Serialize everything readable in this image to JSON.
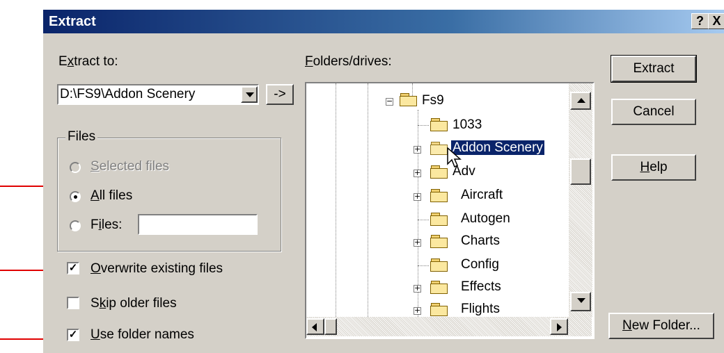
{
  "window": {
    "title": "Extract",
    "help_btn": "?",
    "close_btn": "X"
  },
  "extract_to": {
    "label": "Extract to:",
    "value": "D:\\FS9\\Addon Scenery",
    "go_btn": "->"
  },
  "files_group": {
    "label": "Files",
    "selected_files": "Selected files",
    "all_files": "All files",
    "files": "Files:",
    "files_value": ""
  },
  "options": {
    "overwrite": {
      "label": "Overwrite existing files",
      "checked": true
    },
    "skip_older": {
      "label": "Skip older files",
      "checked": false
    },
    "use_folder_names": {
      "label": "Use folder names",
      "checked": true
    }
  },
  "folders": {
    "label": "Folders/drives:",
    "items": [
      "Fs9",
      "1033",
      "Addon Scenery",
      "Adv",
      "Aircraft",
      "Autogen",
      "Charts",
      "Config",
      "Effects",
      "Flights"
    ]
  },
  "buttons": {
    "extract": "Extract",
    "cancel": "Cancel",
    "help": "Help",
    "new_folder": "New Folder..."
  },
  "colors": {
    "selection": "#0a246a",
    "dialog_bg": "#d4d0c8",
    "annotation_arrow": "#e00000"
  }
}
